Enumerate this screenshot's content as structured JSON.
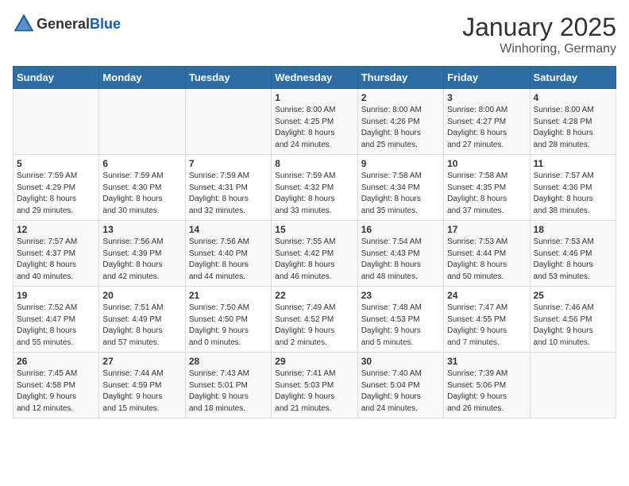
{
  "header": {
    "logo_general": "General",
    "logo_blue": "Blue",
    "month": "January 2025",
    "location": "Winhoring, Germany"
  },
  "weekdays": [
    "Sunday",
    "Monday",
    "Tuesday",
    "Wednesday",
    "Thursday",
    "Friday",
    "Saturday"
  ],
  "weeks": [
    [
      {
        "day": "",
        "info": ""
      },
      {
        "day": "",
        "info": ""
      },
      {
        "day": "",
        "info": ""
      },
      {
        "day": "1",
        "info": "Sunrise: 8:00 AM\nSunset: 4:25 PM\nDaylight: 8 hours\nand 24 minutes."
      },
      {
        "day": "2",
        "info": "Sunrise: 8:00 AM\nSunset: 4:26 PM\nDaylight: 8 hours\nand 25 minutes."
      },
      {
        "day": "3",
        "info": "Sunrise: 8:00 AM\nSunset: 4:27 PM\nDaylight: 8 hours\nand 27 minutes."
      },
      {
        "day": "4",
        "info": "Sunrise: 8:00 AM\nSunset: 4:28 PM\nDaylight: 8 hours\nand 28 minutes."
      }
    ],
    [
      {
        "day": "5",
        "info": "Sunrise: 7:59 AM\nSunset: 4:29 PM\nDaylight: 8 hours\nand 29 minutes."
      },
      {
        "day": "6",
        "info": "Sunrise: 7:59 AM\nSunset: 4:30 PM\nDaylight: 8 hours\nand 30 minutes."
      },
      {
        "day": "7",
        "info": "Sunrise: 7:59 AM\nSunset: 4:31 PM\nDaylight: 8 hours\nand 32 minutes."
      },
      {
        "day": "8",
        "info": "Sunrise: 7:59 AM\nSunset: 4:32 PM\nDaylight: 8 hours\nand 33 minutes."
      },
      {
        "day": "9",
        "info": "Sunrise: 7:58 AM\nSunset: 4:34 PM\nDaylight: 8 hours\nand 35 minutes."
      },
      {
        "day": "10",
        "info": "Sunrise: 7:58 AM\nSunset: 4:35 PM\nDaylight: 8 hours\nand 37 minutes."
      },
      {
        "day": "11",
        "info": "Sunrise: 7:57 AM\nSunset: 4:36 PM\nDaylight: 8 hours\nand 38 minutes."
      }
    ],
    [
      {
        "day": "12",
        "info": "Sunrise: 7:57 AM\nSunset: 4:37 PM\nDaylight: 8 hours\nand 40 minutes."
      },
      {
        "day": "13",
        "info": "Sunrise: 7:56 AM\nSunset: 4:39 PM\nDaylight: 8 hours\nand 42 minutes."
      },
      {
        "day": "14",
        "info": "Sunrise: 7:56 AM\nSunset: 4:40 PM\nDaylight: 8 hours\nand 44 minutes."
      },
      {
        "day": "15",
        "info": "Sunrise: 7:55 AM\nSunset: 4:42 PM\nDaylight: 8 hours\nand 46 minutes."
      },
      {
        "day": "16",
        "info": "Sunrise: 7:54 AM\nSunset: 4:43 PM\nDaylight: 8 hours\nand 48 minutes."
      },
      {
        "day": "17",
        "info": "Sunrise: 7:53 AM\nSunset: 4:44 PM\nDaylight: 8 hours\nand 50 minutes."
      },
      {
        "day": "18",
        "info": "Sunrise: 7:53 AM\nSunset: 4:46 PM\nDaylight: 8 hours\nand 53 minutes."
      }
    ],
    [
      {
        "day": "19",
        "info": "Sunrise: 7:52 AM\nSunset: 4:47 PM\nDaylight: 8 hours\nand 55 minutes."
      },
      {
        "day": "20",
        "info": "Sunrise: 7:51 AM\nSunset: 4:49 PM\nDaylight: 8 hours\nand 57 minutes."
      },
      {
        "day": "21",
        "info": "Sunrise: 7:50 AM\nSunset: 4:50 PM\nDaylight: 9 hours\nand 0 minutes."
      },
      {
        "day": "22",
        "info": "Sunrise: 7:49 AM\nSunset: 4:52 PM\nDaylight: 9 hours\nand 2 minutes."
      },
      {
        "day": "23",
        "info": "Sunrise: 7:48 AM\nSunset: 4:53 PM\nDaylight: 9 hours\nand 5 minutes."
      },
      {
        "day": "24",
        "info": "Sunrise: 7:47 AM\nSunset: 4:55 PM\nDaylight: 9 hours\nand 7 minutes."
      },
      {
        "day": "25",
        "info": "Sunrise: 7:46 AM\nSunset: 4:56 PM\nDaylight: 9 hours\nand 10 minutes."
      }
    ],
    [
      {
        "day": "26",
        "info": "Sunrise: 7:45 AM\nSunset: 4:58 PM\nDaylight: 9 hours\nand 12 minutes."
      },
      {
        "day": "27",
        "info": "Sunrise: 7:44 AM\nSunset: 4:59 PM\nDaylight: 9 hours\nand 15 minutes."
      },
      {
        "day": "28",
        "info": "Sunrise: 7:43 AM\nSunset: 5:01 PM\nDaylight: 9 hours\nand 18 minutes."
      },
      {
        "day": "29",
        "info": "Sunrise: 7:41 AM\nSunset: 5:03 PM\nDaylight: 9 hours\nand 21 minutes."
      },
      {
        "day": "30",
        "info": "Sunrise: 7:40 AM\nSunset: 5:04 PM\nDaylight: 9 hours\nand 24 minutes."
      },
      {
        "day": "31",
        "info": "Sunrise: 7:39 AM\nSunset: 5:06 PM\nDaylight: 9 hours\nand 26 minutes."
      },
      {
        "day": "",
        "info": ""
      }
    ]
  ]
}
